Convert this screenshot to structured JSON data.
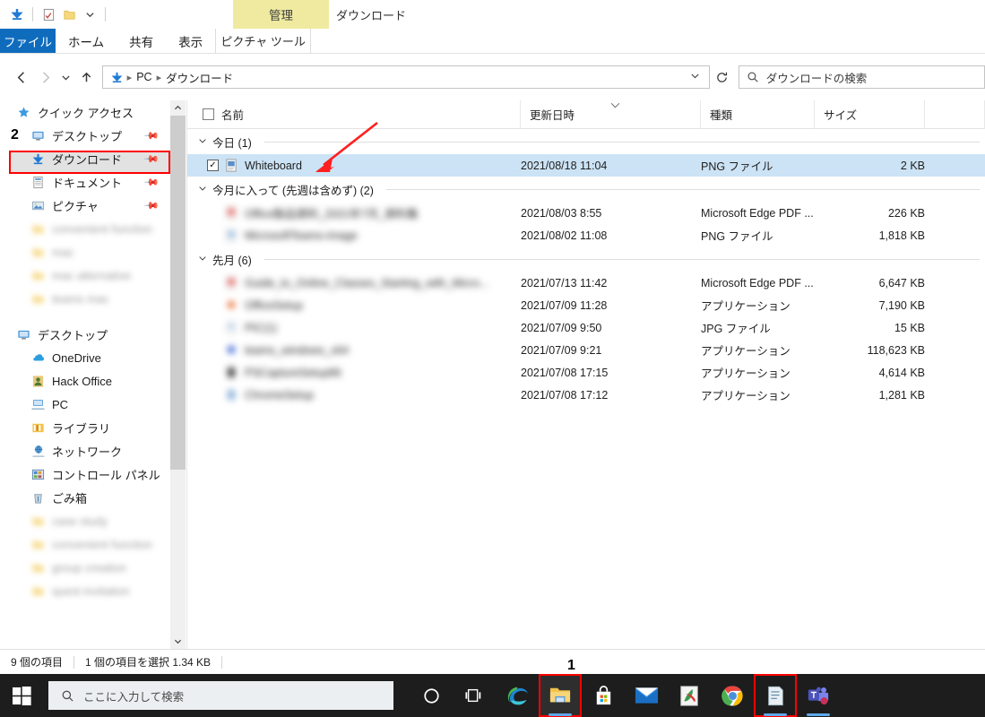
{
  "window": {
    "context_tab_label": "管理",
    "title": "ダウンロード",
    "quick_access_icons": [
      "download-icon",
      "properties-icon",
      "new-folder-icon",
      "customize-chevron-icon"
    ]
  },
  "ribbon": {
    "tabs": [
      {
        "label": "ファイル",
        "active": true
      },
      {
        "label": "ホーム",
        "active": false
      },
      {
        "label": "共有",
        "active": false
      },
      {
        "label": "表示",
        "active": false
      }
    ],
    "contextual_group": "ピクチャ ツール",
    "contextual_group_header": "管理",
    "contextual_color": "#efeaa0"
  },
  "nav": {
    "back_icon": "arrow-left-icon",
    "forward_icon": "arrow-right-icon",
    "recent_icon": "chevron-down-icon",
    "up_icon": "arrow-up-icon",
    "breadcrumb": [
      "PC",
      "ダウンロード"
    ],
    "breadcrumb_leading_icon": "download-folder-icon",
    "dropdown_icon": "chevron-down-icon",
    "refresh_icon": "refresh-icon",
    "search_icon": "search-icon",
    "search_placeholder": "ダウンロードの検索"
  },
  "sidebar": {
    "quick_access": {
      "label": "クイック アクセス",
      "icon": "star-icon"
    },
    "pinned": [
      {
        "label": "デスクトップ",
        "icon": "desktop-icon",
        "pinned": true,
        "blurred": false
      },
      {
        "label": "ダウンロード",
        "icon": "download-icon",
        "pinned": true,
        "blurred": false,
        "selected": true
      },
      {
        "label": "ドキュメント",
        "icon": "documents-icon",
        "pinned": true,
        "blurred": false
      },
      {
        "label": "ピクチャ",
        "icon": "pictures-icon",
        "pinned": true,
        "blurred": false
      },
      {
        "label": "convenient function",
        "icon": "folder-icon",
        "pinned": false,
        "blurred": true
      },
      {
        "label": "mac",
        "icon": "folder-icon",
        "pinned": false,
        "blurred": true
      },
      {
        "label": "mac alternative",
        "icon": "folder-icon",
        "pinned": false,
        "blurred": true
      },
      {
        "label": "teams mac",
        "icon": "folder-icon",
        "pinned": false,
        "blurred": true
      }
    ],
    "tree": [
      {
        "label": "デスクトップ",
        "icon": "desktop-icon",
        "blurred": false
      },
      {
        "label": "OneDrive",
        "icon": "onedrive-icon",
        "blurred": false
      },
      {
        "label": "Hack Office",
        "icon": "user-icon",
        "blurred": false
      },
      {
        "label": "PC",
        "icon": "pc-icon",
        "blurred": false
      },
      {
        "label": "ライブラリ",
        "icon": "library-icon",
        "blurred": false
      },
      {
        "label": "ネットワーク",
        "icon": "network-icon",
        "blurred": false
      },
      {
        "label": "コントロール パネル",
        "icon": "control-panel-icon",
        "blurred": false
      },
      {
        "label": "ごみ箱",
        "icon": "recycle-bin-icon",
        "blurred": false
      },
      {
        "label": "case study",
        "icon": "folder-icon",
        "blurred": true
      },
      {
        "label": "convenient function",
        "icon": "folder-icon",
        "blurred": true
      },
      {
        "label": "group creation",
        "icon": "folder-icon",
        "blurred": true
      },
      {
        "label": "quest invitation",
        "icon": "folder-icon",
        "blurred": true
      }
    ],
    "scroll_up_icon": "chevron-up-icon",
    "scroll_down_icon": "chevron-down-icon"
  },
  "filelist": {
    "columns": [
      {
        "key": "name",
        "label": "名前"
      },
      {
        "key": "modified",
        "label": "更新日時",
        "sorted": true,
        "sort_icon": "chevron-down-icon"
      },
      {
        "key": "type",
        "label": "種類"
      },
      {
        "key": "size",
        "label": "サイズ"
      }
    ],
    "groups": [
      {
        "label": "今日 (1)",
        "chevron": "chevron-down-icon",
        "rows": [
          {
            "name": "Whiteboard",
            "modified": "2021/08/18 11:04",
            "type": "PNG ファイル",
            "size": "2 KB",
            "selected": true,
            "checked": true,
            "blurred": false,
            "icon": "png-file-icon",
            "icon_color": "#5b8fc9"
          }
        ]
      },
      {
        "label": "今月に入って (先週は含めず) (2)",
        "chevron": "chevron-down-icon",
        "rows": [
          {
            "name": "Office製品資料_2021年7月_資料集",
            "modified": "2021/08/03 8:55",
            "type": "Microsoft Edge PDF ...",
            "size": "226 KB",
            "selected": false,
            "checked": false,
            "blurred": true,
            "icon": "pdf-file-icon",
            "icon_color": "#e8534f"
          },
          {
            "name": "MicrosoftTeams-image",
            "modified": "2021/08/02 11:08",
            "type": "PNG ファイル",
            "size": "1,818 KB",
            "selected": false,
            "checked": false,
            "blurred": true,
            "icon": "png-file-icon",
            "icon_color": "#6fa8dc"
          }
        ]
      },
      {
        "label": "先月 (6)",
        "chevron": "chevron-down-icon",
        "rows": [
          {
            "name": "Guide_to_Online_Classes_Starting_with_Micro...",
            "modified": "2021/07/13 11:42",
            "type": "Microsoft Edge PDF ...",
            "size": "6,647 KB",
            "selected": false,
            "checked": false,
            "blurred": true,
            "icon": "pdf-file-icon",
            "icon_color": "#e8534f"
          },
          {
            "name": "OfficeSetup",
            "modified": "2021/07/09 11:28",
            "type": "アプリケーション",
            "size": "7,190 KB",
            "selected": false,
            "checked": false,
            "blurred": true,
            "icon": "app-icon",
            "icon_color": "#e8763f"
          },
          {
            "name": "PIC(1)",
            "modified": "2021/07/09 9:50",
            "type": "JPG ファイル",
            "size": "15 KB",
            "selected": false,
            "checked": false,
            "blurred": true,
            "icon": "jpg-file-icon",
            "icon_color": "#87b6dd"
          },
          {
            "name": "teams_windows_x64",
            "modified": "2021/07/09 9:21",
            "type": "アプリケーション",
            "size": "118,623 KB",
            "selected": false,
            "checked": false,
            "blurred": true,
            "icon": "app-icon",
            "icon_color": "#4a6fd4"
          },
          {
            "name": "PSCaptureSetup86",
            "modified": "2021/07/08 17:15",
            "type": "アプリケーション",
            "size": "4,614 KB",
            "selected": false,
            "checked": false,
            "blurred": true,
            "icon": "app-icon",
            "icon_color": "#4a4a4a"
          },
          {
            "name": "ChromeSetup",
            "modified": "2021/07/08 17:12",
            "type": "アプリケーション",
            "size": "1,281 KB",
            "selected": false,
            "checked": false,
            "blurred": true,
            "icon": "app-icon",
            "icon_color": "#8fb4d9"
          }
        ]
      }
    ]
  },
  "statusbar": {
    "item_count": "9 個の項目",
    "selection": "1 個の項目を選択  1.34 KB"
  },
  "taskbar": {
    "start_icon": "windows-start-icon",
    "search_icon": "search-icon",
    "search_placeholder": "ここに入力して検索",
    "items": [
      {
        "name": "cortana-icon",
        "active": false,
        "boxed": false,
        "underline": false
      },
      {
        "name": "task-view-icon",
        "active": false,
        "boxed": false,
        "underline": false
      },
      {
        "name": "microsoft-edge-icon",
        "active": false,
        "boxed": false,
        "underline": false
      },
      {
        "name": "file-explorer-icon",
        "active": true,
        "boxed": true,
        "underline": true
      },
      {
        "name": "microsoft-store-icon",
        "active": false,
        "boxed": false,
        "underline": false
      },
      {
        "name": "mail-icon",
        "active": false,
        "boxed": false,
        "underline": false
      },
      {
        "name": "acrobat-reader-icon",
        "active": false,
        "boxed": false,
        "underline": false
      },
      {
        "name": "google-chrome-icon",
        "active": false,
        "boxed": false,
        "underline": false
      },
      {
        "name": "notes-app-icon",
        "active": false,
        "boxed": true,
        "underline": true
      },
      {
        "name": "microsoft-teams-icon",
        "active": false,
        "boxed": false,
        "underline": true
      }
    ]
  },
  "annotations": {
    "marker_1": "1",
    "marker_2": "2",
    "arrow_color": "#ff2020",
    "highlight_color": "#ff0000"
  }
}
